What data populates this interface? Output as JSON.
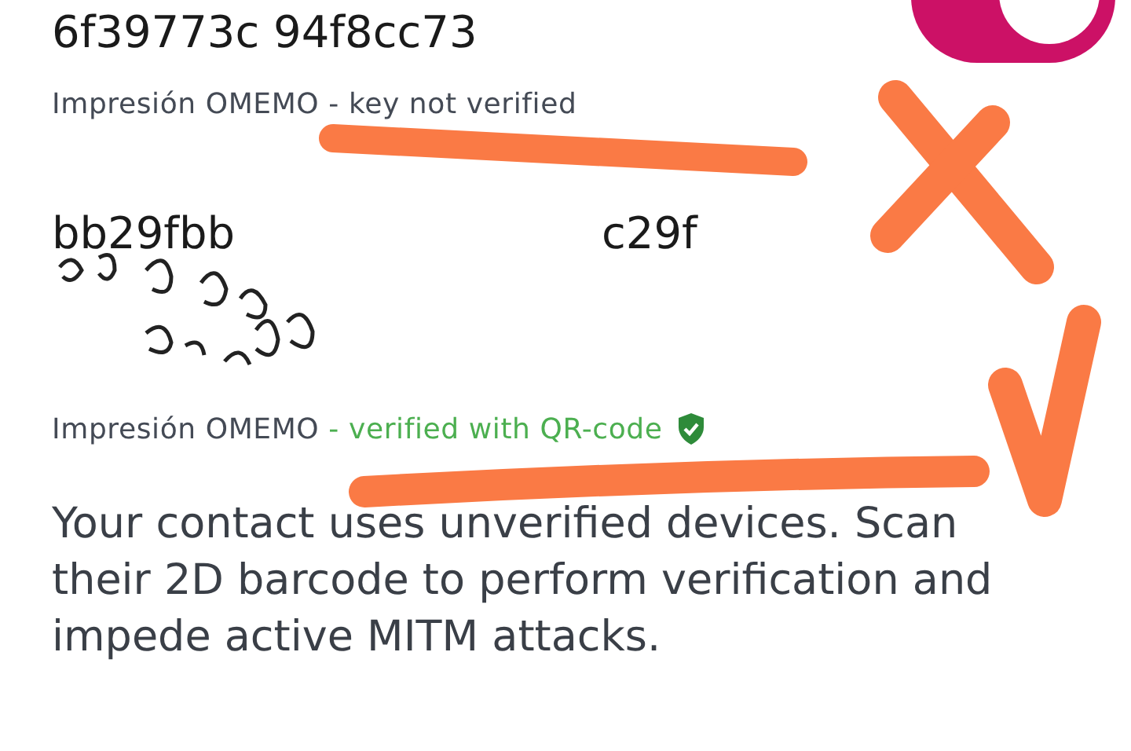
{
  "keys": [
    {
      "fingerprint_lines": [
        "6f39773c 94f8cc73"
      ],
      "label": "Impresión OMEMO",
      "status": "- key not verified",
      "kind": "unverified",
      "switch_on": true
    },
    {
      "fingerprint_lines": [
        "bb29fbb",
        "c29f"
      ],
      "label": "Impresión OMEMO",
      "status": "- verified with QR-code",
      "kind": "verified",
      "garbled": true
    }
  ],
  "notice": "Your contact uses unverified devices. Scan their 2D barcode to perform verification and impede active MITM attacks."
}
